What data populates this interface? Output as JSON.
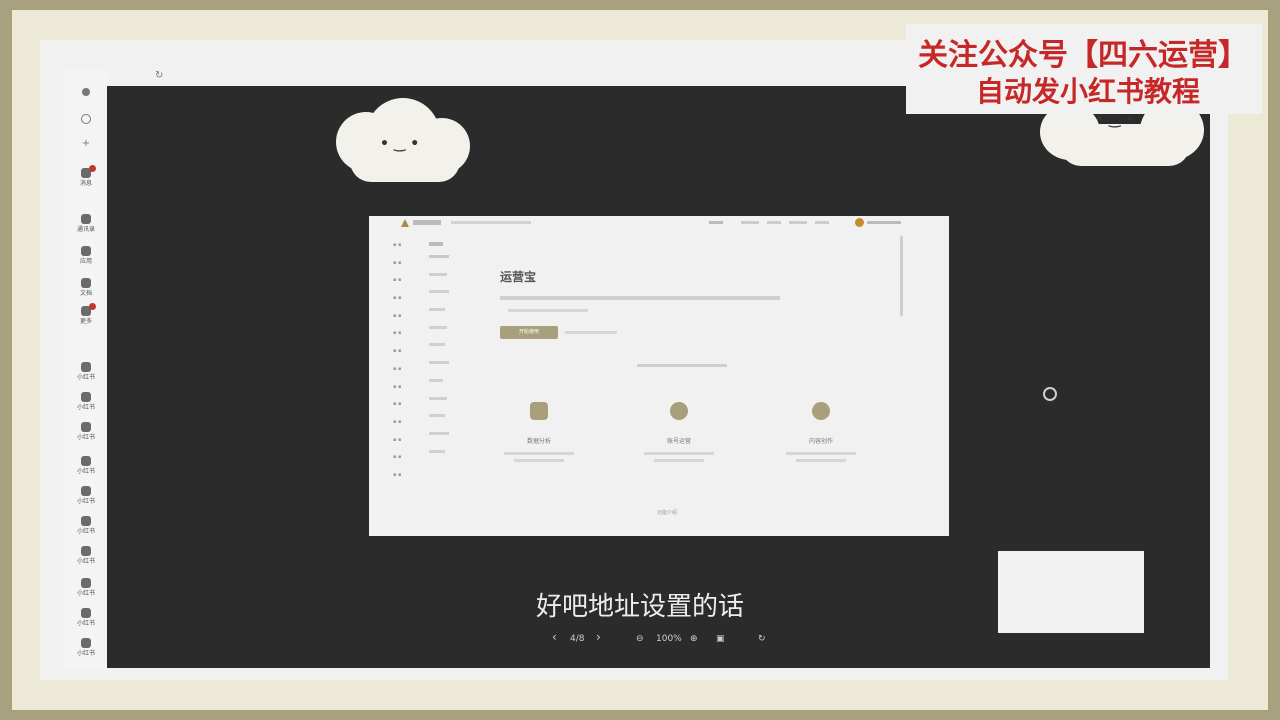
{
  "banner": {
    "line1": "关注公众号【四六运营】",
    "line2": "自动发小红书教程"
  },
  "rail": {
    "items": [
      {
        "label": "消息",
        "icon": "bell-icon"
      },
      {
        "label": "通讯录",
        "icon": "contacts-icon"
      },
      {
        "label": "应用",
        "icon": "grid-icon"
      },
      {
        "label": "文档",
        "icon": "document-icon"
      },
      {
        "label": "更多",
        "icon": "more-icon"
      }
    ],
    "note_items": [
      "小红书",
      "小红书",
      "小红书",
      "小红书",
      "小红书",
      "小红书",
      "小红书",
      "小红书",
      "小红书",
      "小红书"
    ]
  },
  "doc": {
    "title": "运营宝",
    "primary_button": "开始使用",
    "features": [
      {
        "name": "数据分析"
      },
      {
        "name": "账号运营"
      },
      {
        "name": "内容创作"
      }
    ],
    "section_label": "功能介绍"
  },
  "subtitle": "好吧地址设置的话",
  "viewer": {
    "page": "4/8",
    "zoom": "100%"
  },
  "colors": {
    "accent": "#a89f7c",
    "banner_text": "#c62828",
    "viewer_bg": "#2b2b2b"
  }
}
